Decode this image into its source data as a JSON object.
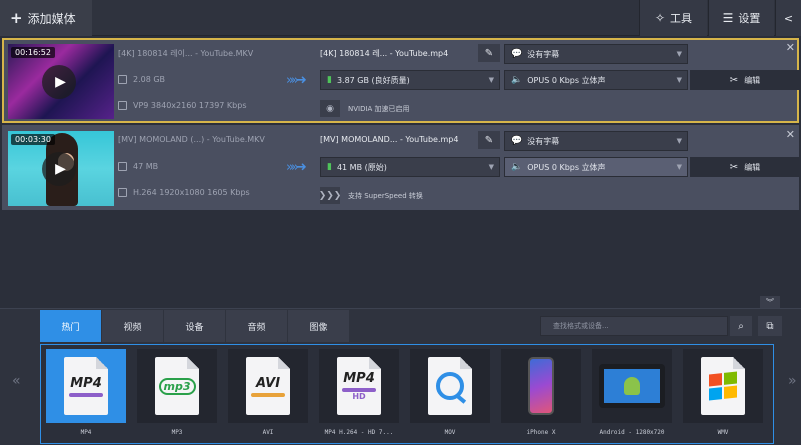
{
  "toolbar": {
    "add_media": "添加媒体",
    "tools": "工具",
    "settings": "设置"
  },
  "files": [
    {
      "duration": "00:16:52",
      "source_name": "[4K] 180814 레이... - YouTube.MKV",
      "source_size": "2.08 GB",
      "source_codec": "VP9 3840x2160 17397 Kbps",
      "output_name": "[4K] 180814 레... - YouTube.mp4",
      "output_size": "3.87 GB (良好质量)",
      "subtitle": "没有字幕",
      "audio": "OPUS 0 Kbps 立体声",
      "hw_accel": "NVIDIA 加速已启用",
      "edit": "编辑"
    },
    {
      "duration": "00:03:30",
      "source_name": "[MV] MOMOLAND (...) - YouTube.MKV",
      "source_size": "47 MB",
      "source_codec": "H.264 1920x1080 1605 Kbps",
      "output_name": "[MV] MOMOLAND... - YouTube.mp4",
      "output_size": "41 MB (原始)",
      "subtitle": "没有字幕",
      "audio": "OPUS 0 Kbps 立体声",
      "hw_accel": "支持 SuperSpeed 转换",
      "edit": "编辑"
    }
  ],
  "bottom": {
    "tabs": [
      "热门",
      "视频",
      "设备",
      "音频",
      "图像"
    ],
    "active_tab": "热门",
    "search_placeholder": "查找格式或设备...",
    "formats": [
      "MP4",
      "MP3",
      "AVI",
      "MP4 H.264 - HD 7...",
      "MOV",
      "iPhone X",
      "Android - 1280x720",
      "WMV"
    ],
    "active_format": "MP4"
  },
  "colors": {
    "accent": "#2f8fe6",
    "selected_border": "#d6b54a",
    "background": "#2b2f3a"
  }
}
